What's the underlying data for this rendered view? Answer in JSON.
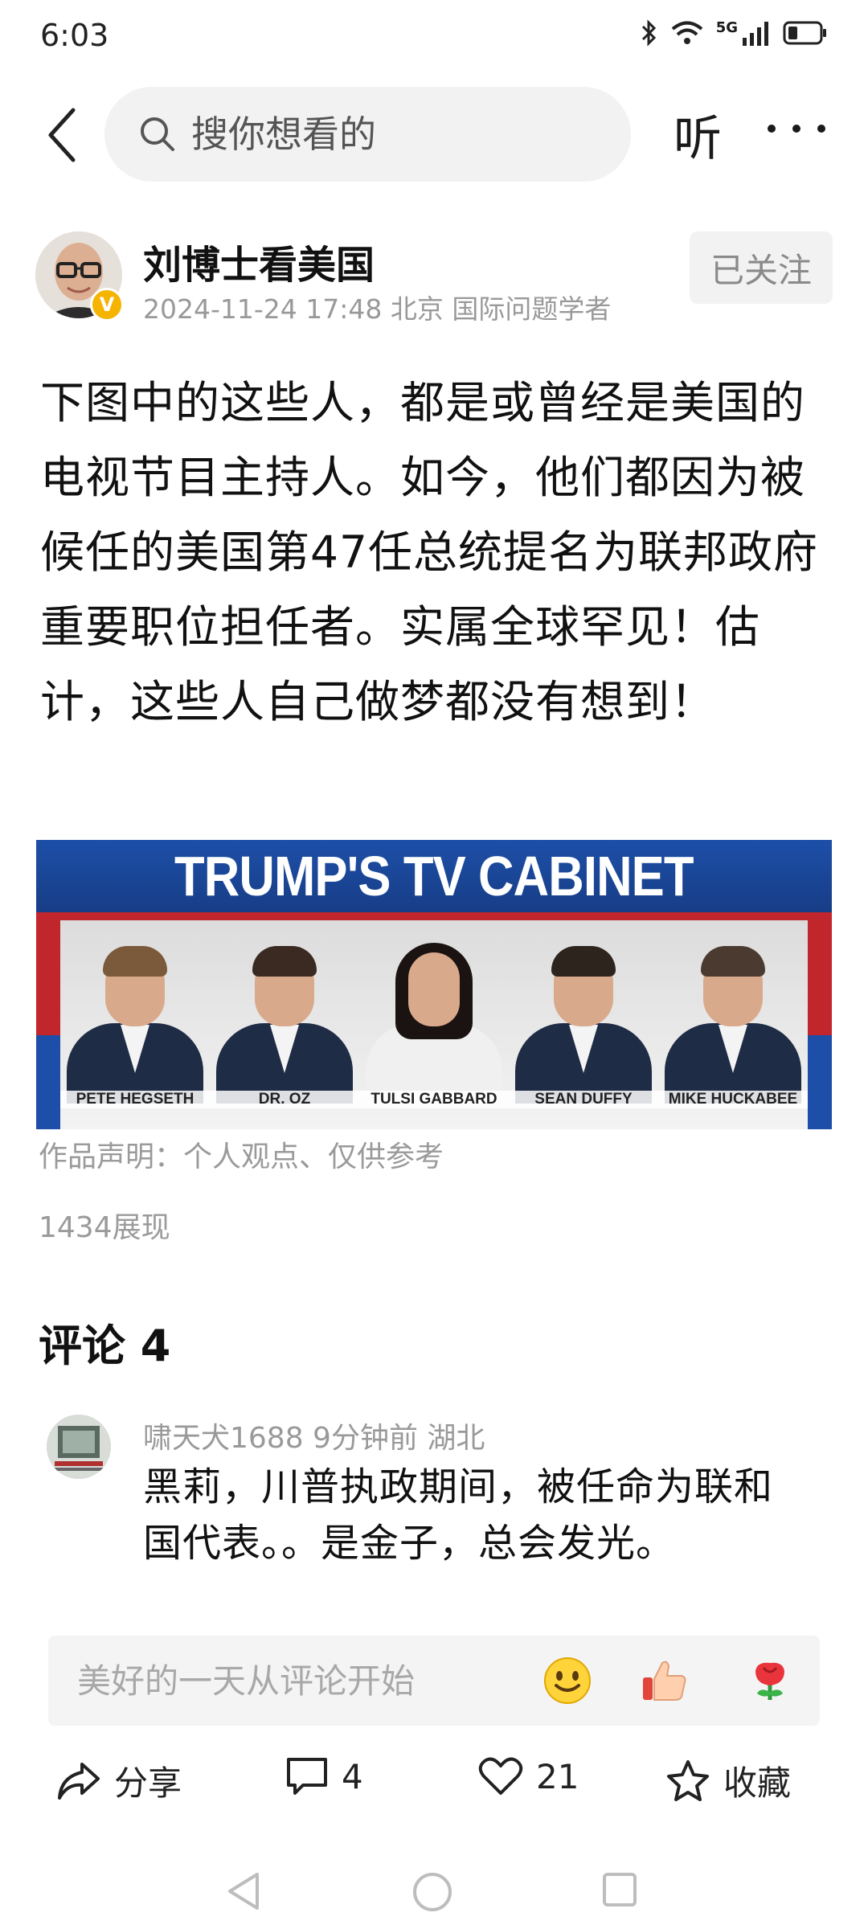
{
  "status_bar": {
    "time": "6:03",
    "network": "5G"
  },
  "nav": {
    "search_placeholder": "搜你想看的",
    "listen_label": "听"
  },
  "author": {
    "name": "刘博士看美国",
    "meta": "2024-11-24 17:48 北京 国际问题学者",
    "verified_badge": "V",
    "follow_label": "已关注"
  },
  "article": {
    "text": "下图中的这些人，都是或曾经是美国的电视节目主持人。如今，他们都因为被候任的美国第47任总统提名为联邦政府重要职位担任者。实属全球罕见！估计，这些人自己做梦都没有想到！",
    "image": {
      "title": "TRUMP'S TV CABINET",
      "people": [
        {
          "name": "PETE HEGSETH"
        },
        {
          "name": "DR. OZ"
        },
        {
          "name": "TULSI GABBARD"
        },
        {
          "name": "SEAN DUFFY"
        },
        {
          "name": "MIKE HUCKABEE"
        }
      ]
    },
    "disclaimer": "作品声明：个人观点、仅供参考",
    "views": "1434展现"
  },
  "comments": {
    "title": "评论 4",
    "items": [
      {
        "meta": "啸天犬1688  9分钟前   湖北",
        "text": "黑莉，川普执政期间，被任命为联和国代表。。是金子，总会发光。"
      }
    ],
    "input_placeholder": "美好的一天从评论开始"
  },
  "actions": {
    "share_label": "分享",
    "comment_count": "4",
    "like_count": "21",
    "favorite_label": "收藏"
  },
  "colors": {
    "accent_gold": "#f5b400",
    "banner_blue": "#1d4fa8",
    "banner_red": "#c0262c"
  }
}
